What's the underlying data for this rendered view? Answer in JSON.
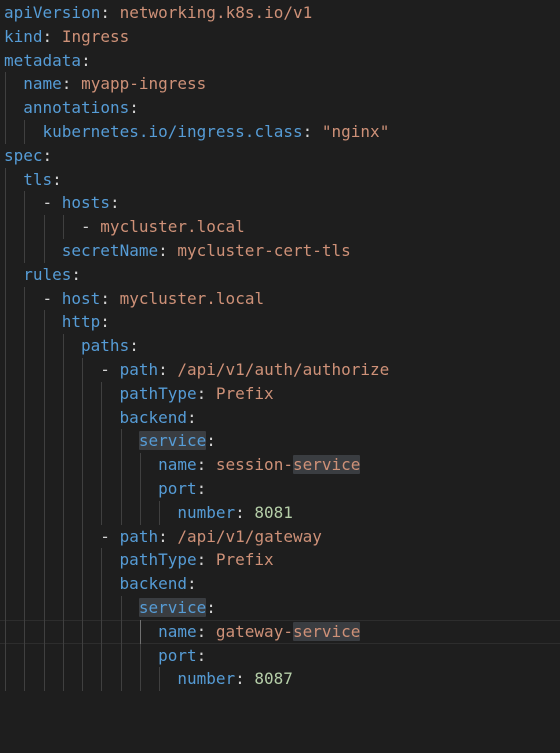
{
  "colors": {
    "background": "#1e1e1e",
    "key": "#569cd6",
    "string": "#ce9178",
    "number": "#b5cea8",
    "punctuation": "#d4d4d4",
    "indent_guide": "#404040",
    "indent_guide_active": "#707070",
    "selection_highlight": "#3a3d41"
  },
  "document": {
    "language": "yaml",
    "lines": [
      {
        "indent": 0,
        "dash": false,
        "key": "apiVersion",
        "value": "networking.k8s.io/v1"
      },
      {
        "indent": 0,
        "dash": false,
        "key": "kind",
        "value": "Ingress"
      },
      {
        "indent": 0,
        "dash": false,
        "key": "metadata",
        "value": ""
      },
      {
        "indent": 1,
        "dash": false,
        "key": "name",
        "value": "myapp-ingress"
      },
      {
        "indent": 1,
        "dash": false,
        "key": "annotations",
        "value": ""
      },
      {
        "indent": 2,
        "dash": false,
        "key": "kubernetes.io/ingress.class",
        "value": "\"nginx\""
      },
      {
        "indent": 0,
        "dash": false,
        "key": "spec",
        "value": ""
      },
      {
        "indent": 1,
        "dash": false,
        "key": "tls",
        "value": ""
      },
      {
        "indent": 2,
        "dash": true,
        "key": "hosts",
        "value": ""
      },
      {
        "indent": 4,
        "dash": true,
        "key": "",
        "value": "mycluster.local"
      },
      {
        "indent": 3,
        "dash": false,
        "key": "secretName",
        "value": "mycluster-cert-tls"
      },
      {
        "indent": 1,
        "dash": false,
        "key": "rules",
        "value": ""
      },
      {
        "indent": 2,
        "dash": true,
        "key": "host",
        "value": "mycluster.local"
      },
      {
        "indent": 3,
        "dash": false,
        "key": "http",
        "value": ""
      },
      {
        "indent": 4,
        "dash": false,
        "key": "paths",
        "value": ""
      },
      {
        "indent": 5,
        "dash": true,
        "key": "path",
        "value": "/api/v1/auth/authorize"
      },
      {
        "indent": 6,
        "dash": false,
        "key": "pathType",
        "value": "Prefix"
      },
      {
        "indent": 6,
        "dash": false,
        "key": "backend",
        "value": ""
      },
      {
        "indent": 7,
        "dash": false,
        "key": "service",
        "key_highlight": true,
        "value": ""
      },
      {
        "indent": 8,
        "dash": false,
        "key": "name",
        "value": "session-service",
        "value_highlight": "service"
      },
      {
        "indent": 8,
        "dash": false,
        "key": "port",
        "value": ""
      },
      {
        "indent": 9,
        "dash": false,
        "key": "number",
        "value": "8081",
        "numeric": true
      },
      {
        "indent": 5,
        "dash": true,
        "key": "path",
        "value": "/api/v1/gateway"
      },
      {
        "indent": 6,
        "dash": false,
        "key": "pathType",
        "value": "Prefix"
      },
      {
        "indent": 6,
        "dash": false,
        "key": "backend",
        "value": ""
      },
      {
        "indent": 7,
        "dash": false,
        "key": "service",
        "key_highlight": true,
        "value": ""
      },
      {
        "indent": 8,
        "dash": false,
        "key": "name",
        "value": "gateway-service",
        "value_highlight": "service",
        "current": true
      },
      {
        "indent": 8,
        "dash": false,
        "key": "port",
        "value": ""
      },
      {
        "indent": 9,
        "dash": false,
        "key": "number",
        "value": "8087",
        "numeric": true
      }
    ]
  }
}
